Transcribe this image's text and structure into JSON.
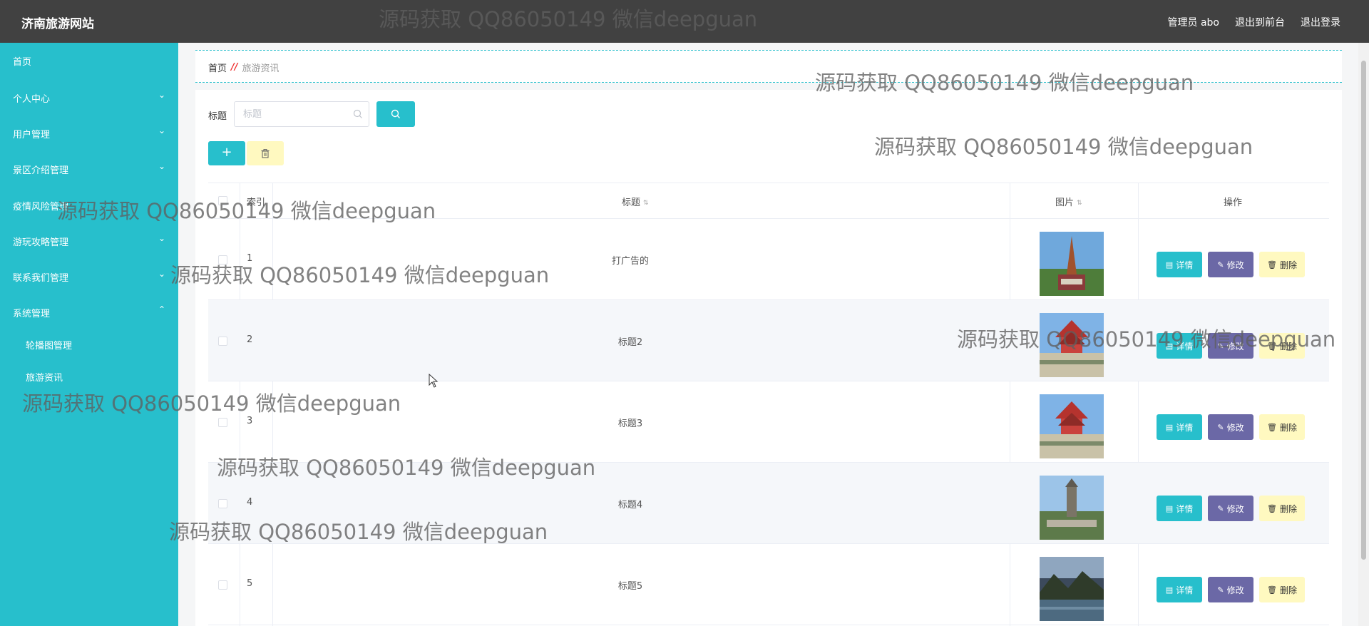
{
  "header": {
    "brand": "济南旅游网站",
    "admin_label": "管理员 abo",
    "front_link": "退出到前台",
    "logout_link": "退出登录"
  },
  "sidebar": {
    "items": [
      {
        "label": "首页"
      },
      {
        "label": "个人中心"
      },
      {
        "label": "用户管理"
      },
      {
        "label": "景区介绍管理"
      },
      {
        "label": "疫情风险管理"
      },
      {
        "label": "游玩攻略管理"
      },
      {
        "label": "联系我们管理"
      },
      {
        "label": "系统管理"
      }
    ],
    "sub_items": [
      {
        "label": "轮播图管理"
      },
      {
        "label": "旅游资讯"
      }
    ]
  },
  "breadcrumb": {
    "home": "首页",
    "sep": "//",
    "current": "旅游资讯"
  },
  "search": {
    "label": "标题",
    "placeholder": "标题"
  },
  "toolbar": {
    "add_label": "+"
  },
  "table": {
    "headers": {
      "index": "索引",
      "title": "标题",
      "image": "图片",
      "actions": "操作"
    },
    "rows": [
      {
        "index": "1",
        "title": "打广告的"
      },
      {
        "index": "2",
        "title": "标题2"
      },
      {
        "index": "3",
        "title": "标题3"
      },
      {
        "index": "4",
        "title": "标题4"
      },
      {
        "index": "5",
        "title": "标题5"
      }
    ],
    "actions": {
      "detail": "详情",
      "edit": "修改",
      "delete": "删除"
    }
  },
  "watermarks": [
    "源码获取 QQ86050149 微信deepguan",
    "源码获取 QQ86050149 微信deepguan",
    "源码获取 QQ86050149 微信deepguan",
    "源码获取 QQ86050149 微信deepguan",
    "源码获取 QQ86050149 微信deepguan",
    "源码获取 QQ86050149 微信deepguan",
    "源码获取 QQ86050149 微信deepguan",
    "源码获取 QQ86050149 微信deepguan",
    "源码获取 QQ86050149 微信deepguan"
  ],
  "colors": {
    "accent": "#27bfcc",
    "topbar": "#414141",
    "edit_button": "#6b68a6",
    "delete_button": "#fff9c0"
  }
}
